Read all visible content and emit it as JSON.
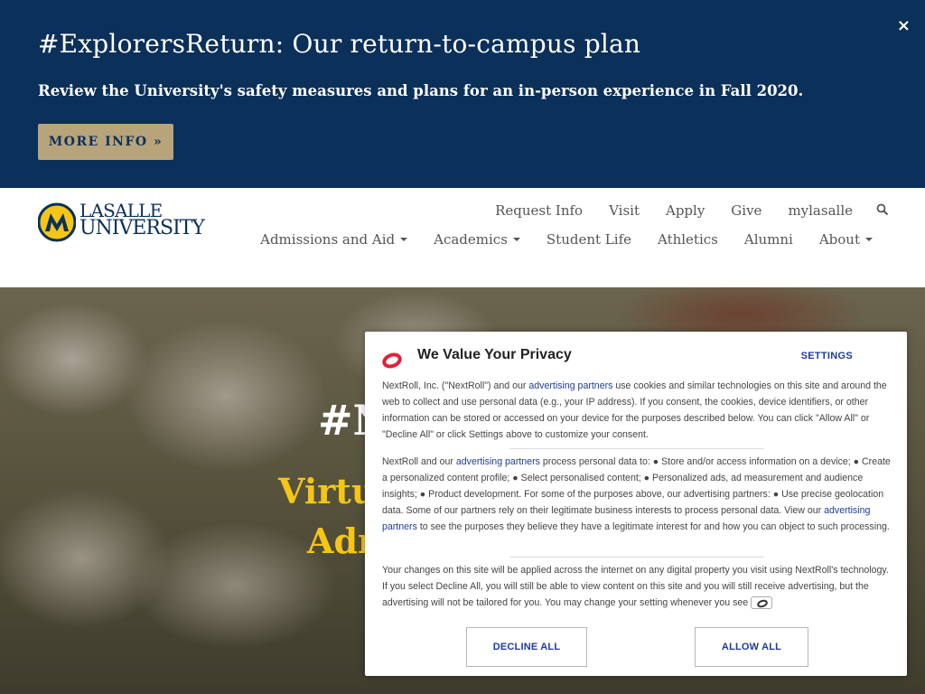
{
  "banner": {
    "title": "#ExplorersReturn: Our return-to-campus plan",
    "subtitle": "Review the University's safety measures and plans for an in-person experience in Fall 2020.",
    "button_label": "MORE INFO »",
    "close_label": "×"
  },
  "logo": {
    "line1": "LASALLE",
    "line2": "UNIVERSITY"
  },
  "utility_nav": [
    {
      "label": "Request Info"
    },
    {
      "label": "Visit"
    },
    {
      "label": "Apply"
    },
    {
      "label": "Give"
    },
    {
      "label": "mylasalle"
    }
  ],
  "main_nav": [
    {
      "label": "Admissions and Aid",
      "dropdown": true
    },
    {
      "label": "Academics",
      "dropdown": true
    },
    {
      "label": "Student Life",
      "dropdown": false
    },
    {
      "label": "Athletics",
      "dropdown": false
    },
    {
      "label": "Alumni",
      "dropdown": false
    },
    {
      "label": "About",
      "dropdown": true
    }
  ],
  "hero": {
    "hashtag": "#N",
    "line1": "Virtu",
    "line2": "Adn"
  },
  "privacy": {
    "title": "We Value Your Privacy",
    "settings_label": "SETTINGS",
    "p1_a": "NextRoll, Inc. (\"NextRoll\") and our ",
    "p1_link": "advertising partners",
    "p1_b": " use cookies and similar technologies on this site and around the web to collect and use personal data (e.g., your IP address). If you consent, the cookies, device identifiers, or other information can be stored or accessed on your device for the purposes described below. You can click \"Allow All\" or \"Decline All\" or click Settings above to customize your consent.",
    "p2_a": "NextRoll and our ",
    "p2_link1": "advertising partners",
    "p2_b": " process personal data to: ● Store and/or access information on a device; ● Create a personalized content profile; ● Select personalised content; ● Personalized ads, ad measurement and audience insights; ● Product development. For some of the purposes above, our advertising partners: ● Use precise geolocation data. Some of our partners rely on their legitimate business interests to process personal data. View our ",
    "p2_link2": "advertising partners",
    "p2_c": " to see the purposes they believe they have a legitimate interest for and how you can object to such processing.",
    "p3": "Your changes on this site will be applied across the internet on any digital property you visit using NextRoll's technology. If you select Decline All, you will still be able to view content on this site and you will still receive advertising, but the advertising will not be tailored for you. You may change your setting whenever you see",
    "decline_label": "DECLINE ALL",
    "allow_label": "ALLOW ALL"
  },
  "colors": {
    "banner_bg": "#0b3059",
    "button_tan": "#b8a47a",
    "hero_gold": "#f5c518",
    "link_blue": "#1d3c9a",
    "nextroll_red": "#e0203a"
  }
}
